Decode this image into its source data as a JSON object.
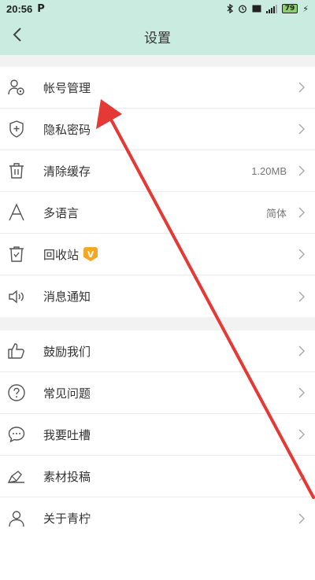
{
  "status": {
    "time": "20:56",
    "app_letter": "P",
    "battery": "79"
  },
  "header": {
    "title": "设置"
  },
  "groups": [
    {
      "items": [
        {
          "label": "帐号管理",
          "value": "",
          "icon": "account-manage-icon"
        },
        {
          "label": "隐私密码",
          "value": "",
          "icon": "privacy-shield-icon"
        },
        {
          "label": "清除缓存",
          "value": "1.20MB",
          "icon": "trash-icon"
        },
        {
          "label": "多语言",
          "value": "简体",
          "icon": "language-icon"
        },
        {
          "label": "回收站",
          "value": "",
          "icon": "recycle-bin-icon",
          "badge": "V"
        },
        {
          "label": "消息通知",
          "value": "",
          "icon": "speaker-icon"
        }
      ]
    },
    {
      "items": [
        {
          "label": "鼓励我们",
          "value": "",
          "icon": "thumbs-up-icon"
        },
        {
          "label": "常见问题",
          "value": "",
          "icon": "question-icon"
        },
        {
          "label": "我要吐槽",
          "value": "",
          "icon": "chat-bubble-icon"
        },
        {
          "label": "素材投稿",
          "value": "",
          "icon": "edit-icon"
        },
        {
          "label": "关于青柠",
          "value": "",
          "icon": "person-icon"
        }
      ]
    }
  ],
  "colors": {
    "header_bg": "#c9ebe0",
    "annotation_arrow": "#e53935",
    "badge": "#f5a623"
  }
}
